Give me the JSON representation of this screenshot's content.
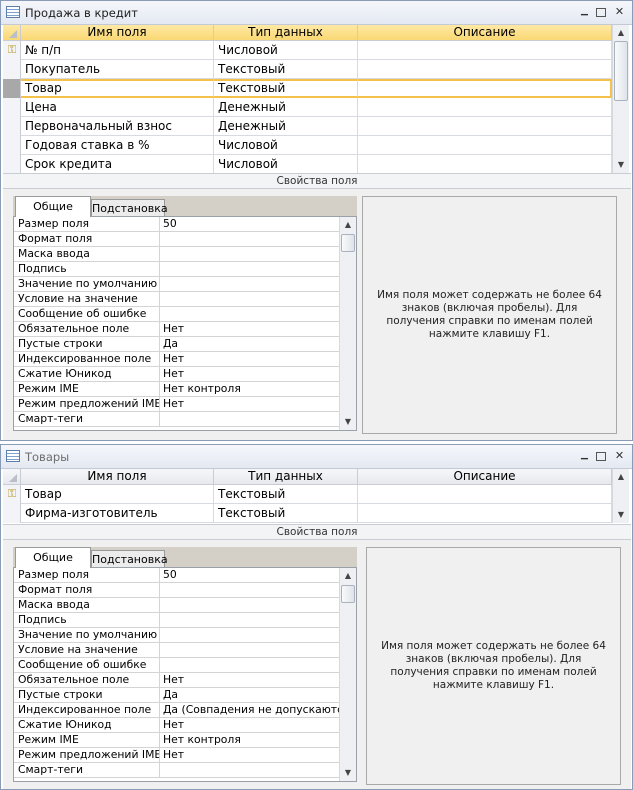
{
  "window1": {
    "title": "Продажа в кредит",
    "columns": [
      "Имя поля",
      "Тип данных",
      "Описание"
    ],
    "rows": [
      {
        "name": "№ п/п",
        "type": "Числовой",
        "desc": "",
        "key": true
      },
      {
        "name": "Покупатель",
        "type": "Текстовый",
        "desc": ""
      },
      {
        "name": "Товар",
        "type": "Текстовый",
        "desc": "",
        "current": true
      },
      {
        "name": "Цена",
        "type": "Денежный",
        "desc": ""
      },
      {
        "name": "Первоначальный взнос",
        "type": "Денежный",
        "desc": ""
      },
      {
        "name": "Годовая ставка в %",
        "type": "Числовой",
        "desc": ""
      },
      {
        "name": "Срок кредита",
        "type": "Числовой",
        "desc": ""
      }
    ],
    "section_label": "Свойства поля",
    "tabs": [
      "Общие",
      "Подстановка"
    ],
    "properties": [
      {
        "name": "Размер поля",
        "value": "50"
      },
      {
        "name": "Формат поля",
        "value": ""
      },
      {
        "name": "Маска ввода",
        "value": ""
      },
      {
        "name": "Подпись",
        "value": ""
      },
      {
        "name": "Значение по умолчанию",
        "value": ""
      },
      {
        "name": "Условие на значение",
        "value": ""
      },
      {
        "name": "Сообщение об ошибке",
        "value": ""
      },
      {
        "name": "Обязательное поле",
        "value": "Нет"
      },
      {
        "name": "Пустые строки",
        "value": "Да"
      },
      {
        "name": "Индексированное поле",
        "value": "Нет"
      },
      {
        "name": "Сжатие Юникод",
        "value": "Нет"
      },
      {
        "name": "Режим IME",
        "value": "Нет контроля"
      },
      {
        "name": "Режим предложений IME",
        "value": "Нет"
      },
      {
        "name": "Смарт-теги",
        "value": ""
      }
    ],
    "hint": "Имя поля может содержать не более 64 знаков (включая пробелы). Для получения справки по именам полей нажмите клавишу F1."
  },
  "window2": {
    "title": "Товары",
    "columns": [
      "Имя поля",
      "Тип данных",
      "Описание"
    ],
    "rows": [
      {
        "name": "Товар",
        "type": "Текстовый",
        "desc": "",
        "key": true
      },
      {
        "name": "Фирма-изготовитель",
        "type": "Текстовый",
        "desc": ""
      }
    ],
    "section_label": "Свойства поля",
    "tabs": [
      "Общие",
      "Подстановка"
    ],
    "properties": [
      {
        "name": "Размер поля",
        "value": "50"
      },
      {
        "name": "Формат поля",
        "value": ""
      },
      {
        "name": "Маска ввода",
        "value": ""
      },
      {
        "name": "Подпись",
        "value": ""
      },
      {
        "name": "Значение по умолчанию",
        "value": ""
      },
      {
        "name": "Условие на значение",
        "value": ""
      },
      {
        "name": "Сообщение об ошибке",
        "value": ""
      },
      {
        "name": "Обязательное поле",
        "value": "Нет"
      },
      {
        "name": "Пустые строки",
        "value": "Да"
      },
      {
        "name": "Индексированное поле",
        "value": "Да (Совпадения не допускаются)"
      },
      {
        "name": "Сжатие Юникод",
        "value": "Нет"
      },
      {
        "name": "Режим IME",
        "value": "Нет контроля"
      },
      {
        "name": "Режим предложений IME",
        "value": "Нет"
      },
      {
        "name": "Смарт-теги",
        "value": ""
      }
    ],
    "hint": "Имя поля может содержать не более 64 знаков (включая пробелы). Для получения справки по именам полей нажмите клавишу F1."
  },
  "icons": {
    "table": "table-icon",
    "minimize": "minimize-icon",
    "restore": "restore-icon",
    "close": "close-icon",
    "key": "primary-key-icon",
    "up": "arrow-up-icon",
    "down": "arrow-down-icon"
  },
  "colors": {
    "active_header": "#f9d873",
    "current_row_border": "#f4c24a",
    "panel_bg": "#f0f0f0"
  }
}
